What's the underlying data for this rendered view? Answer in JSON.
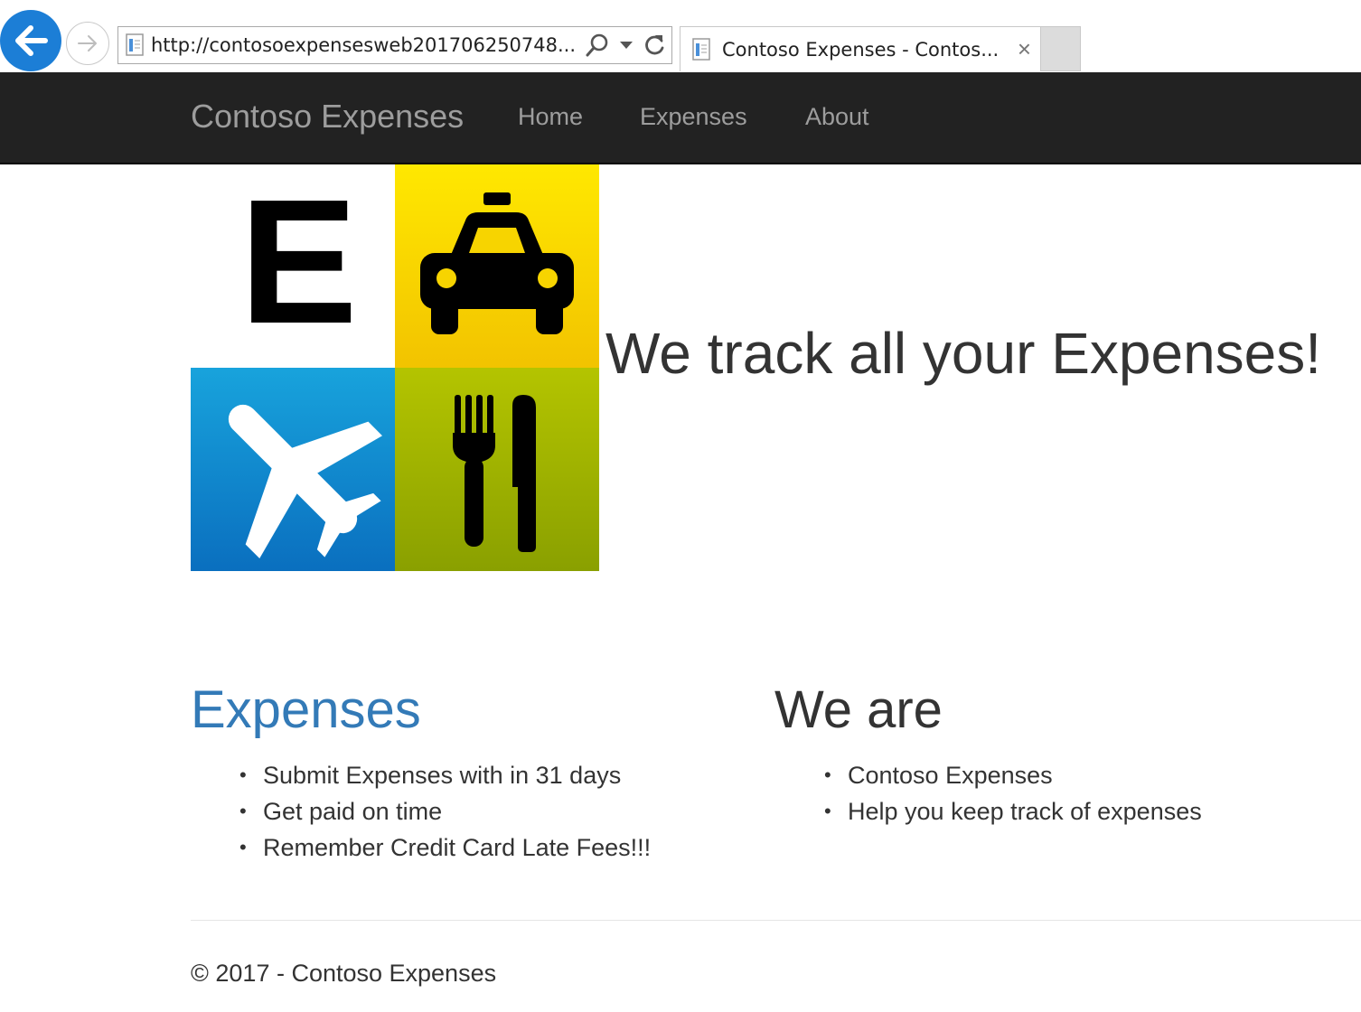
{
  "browser": {
    "address_url": "http://contosoexpensesweb201706250748...",
    "tab_title": "Contoso Expenses - Contos...",
    "tab_close": "×"
  },
  "navbar": {
    "brand": "Contoso Expenses",
    "links": [
      "Home",
      "Expenses",
      "About"
    ]
  },
  "hero": {
    "image": {
      "tiles": [
        "letter-e",
        "taxi",
        "airplane",
        "fork-knife"
      ],
      "letter": "E",
      "colors": {
        "tile1": "#ffffff",
        "tile2": "#f5d000",
        "tile3": "#1a8fd0",
        "tile4": "#99b000"
      }
    },
    "headline": "We track all your Expenses!"
  },
  "columns": [
    {
      "title": "Expenses",
      "title_color": "#337ab7",
      "items": [
        "Submit Expenses with in 31 days",
        "Get paid on time",
        "Remember Credit Card Late Fees!!!"
      ]
    },
    {
      "title": "We are",
      "title_color": "#333333",
      "items": [
        "Contoso Expenses",
        "Help you keep track of expenses"
      ]
    }
  ],
  "footer": {
    "text": "© 2017 - Contoso Expenses"
  },
  "colors": {
    "navbar_bg": "#222222",
    "nav_text": "#9d9d9d",
    "link_blue": "#337ab7",
    "back_button": "#1c7ed6"
  }
}
